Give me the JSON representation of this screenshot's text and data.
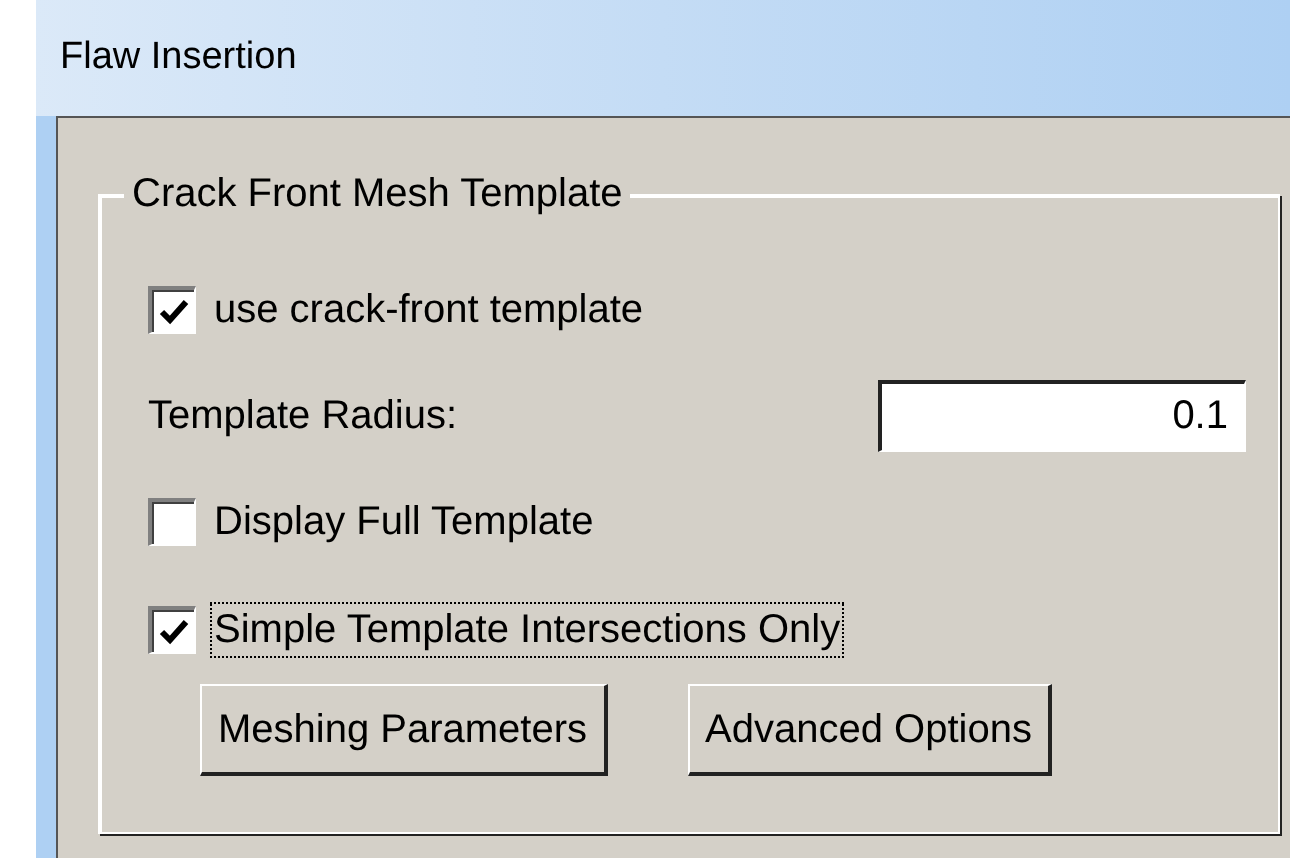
{
  "window": {
    "title": "Flaw Insertion"
  },
  "group": {
    "title": "Crack Front Mesh Template",
    "rows": [
      {
        "kind": "checkbox",
        "label": "use crack-front template",
        "checked": true,
        "focused": false
      },
      {
        "kind": "field",
        "label": "Template Radius:",
        "value": "0.1"
      },
      {
        "kind": "checkbox",
        "label": "Display Full Template",
        "checked": false,
        "focused": false
      },
      {
        "kind": "checkbox",
        "label": "Simple Template Intersections Only",
        "checked": true,
        "focused": true
      }
    ],
    "buttons": [
      "Meshing Parameters",
      "Advanced Options"
    ]
  }
}
